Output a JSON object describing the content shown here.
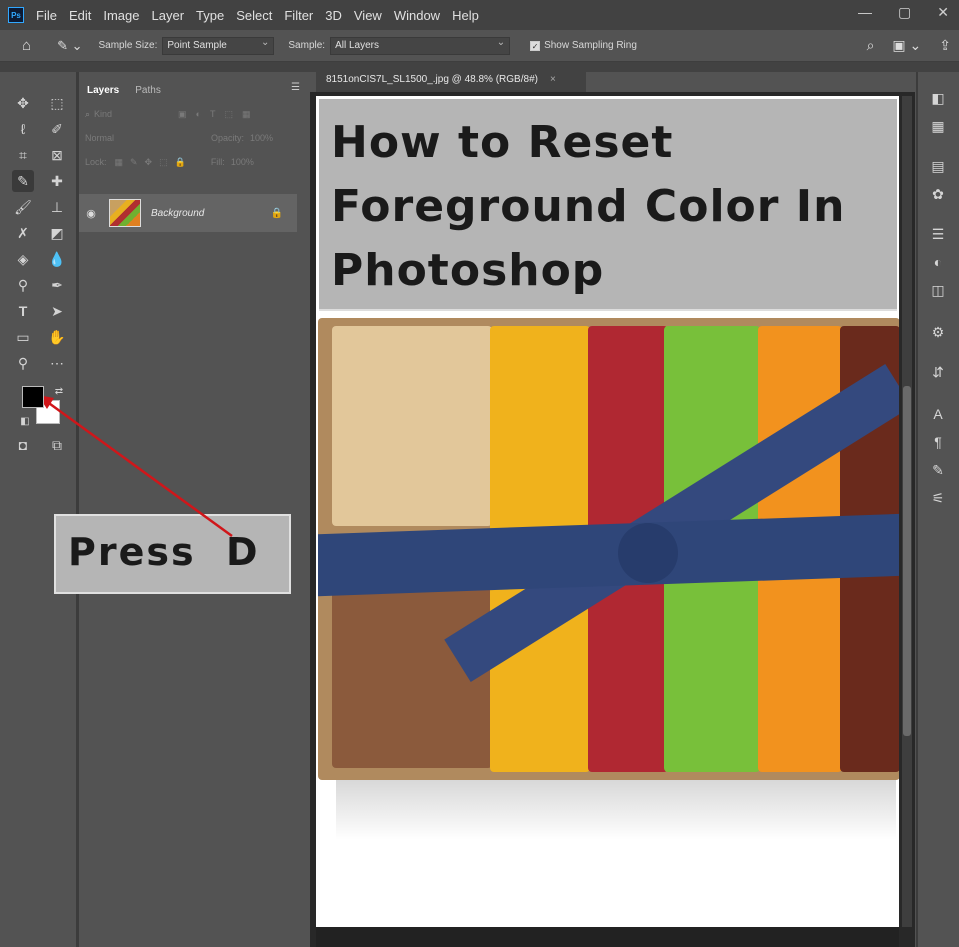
{
  "app": "Photoshop",
  "menu": [
    "File",
    "Edit",
    "Image",
    "Layer",
    "Type",
    "Select",
    "Filter",
    "3D",
    "View",
    "Window",
    "Help"
  ],
  "logo": "Ps",
  "window_controls": [
    "—",
    "▢",
    "✕"
  ],
  "options": {
    "sample_size_label": "Sample Size:",
    "sample_size_value": "Point Sample",
    "sample_label": "Sample:",
    "sample_value": "All Layers",
    "show_ring_label": "Show Sampling Ring",
    "show_ring_checked": true
  },
  "layers_panel": {
    "tabs": [
      "Layers",
      "Paths"
    ],
    "search_placeholder": "Kind",
    "blend_mode": "Normal",
    "opacity_label": "Opacity:",
    "opacity_value": "100%",
    "lock_label": "Lock:",
    "fill_label": "Fill:",
    "fill_value": "100%",
    "layer_name": "Background"
  },
  "document_tab": {
    "title": "8151onCIS7L_SL1500_.jpg @ 48.8% (RGB/8#)",
    "close": "×"
  },
  "canvas": {
    "title_lines": [
      "How to Reset",
      "Foreground Color In",
      "Photoshop"
    ]
  },
  "callout": {
    "text": "Press  D"
  },
  "colors": {
    "foreground": "#000000",
    "background": "#ffffff",
    "arrow": "#d0161a"
  }
}
